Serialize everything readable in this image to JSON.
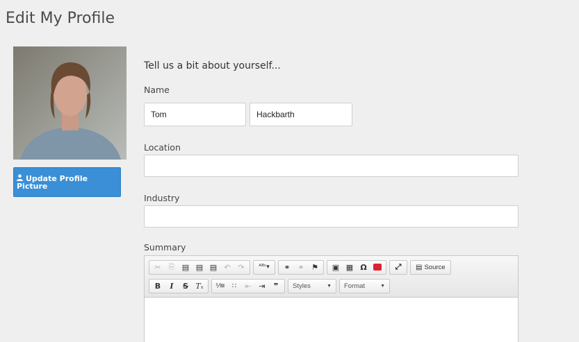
{
  "page_title": "Edit My Profile",
  "profile": {
    "update_button_label": "Update Profile Picture",
    "update_button_icon": "user-icon"
  },
  "form": {
    "intro": "Tell us a bit about yourself...",
    "name_label": "Name",
    "first_name": "Tom",
    "last_name": "Hackbarth",
    "location_label": "Location",
    "location_value": "",
    "industry_label": "Industry",
    "industry_value": "",
    "summary_label": "Summary"
  },
  "editor": {
    "row1": [
      {
        "name": "cut-icon",
        "glyph": "✂",
        "disabled": true
      },
      {
        "name": "copy-icon",
        "glyph": "⎘",
        "disabled": true
      },
      {
        "name": "paste-icon",
        "glyph": "📋",
        "disabled": false
      },
      {
        "name": "paste-text-icon",
        "glyph": "📋",
        "disabled": false
      },
      {
        "name": "paste-word-icon",
        "glyph": "📋",
        "disabled": false
      },
      {
        "name": "undo-icon",
        "glyph": "↶",
        "disabled": true
      },
      {
        "name": "redo-icon",
        "glyph": "↷",
        "disabled": true
      },
      {
        "name": "spellcheck-icon",
        "glyph": "ᴬᴮᶜ▾",
        "disabled": false
      },
      {
        "name": "link-icon",
        "glyph": "🔗",
        "disabled": false
      },
      {
        "name": "unlink-icon",
        "glyph": "⛓",
        "disabled": true
      },
      {
        "name": "anchor-icon",
        "glyph": "⚑",
        "disabled": false
      },
      {
        "name": "image-icon",
        "glyph": "▣",
        "disabled": false
      },
      {
        "name": "table-icon",
        "glyph": "▦",
        "disabled": false
      },
      {
        "name": "special-char-icon",
        "glyph": "Ω",
        "disabled": false
      },
      {
        "name": "youtube-icon",
        "glyph": "",
        "disabled": false
      },
      {
        "name": "maximize-icon",
        "glyph": "⤢",
        "disabled": false
      }
    ],
    "source_label": "Source",
    "row2": [
      {
        "name": "bold-icon",
        "glyph": "B",
        "cls": "b"
      },
      {
        "name": "italic-icon",
        "glyph": "I",
        "cls": "i"
      },
      {
        "name": "strike-icon",
        "glyph": "S",
        "cls": "s"
      },
      {
        "name": "remove-format-icon",
        "glyph": "Tₓ",
        "cls": "i"
      },
      {
        "name": "numbered-list-icon",
        "glyph": "⒈≡",
        "cls": ""
      },
      {
        "name": "bulleted-list-icon",
        "glyph": "•≡",
        "cls": ""
      },
      {
        "name": "outdent-icon",
        "glyph": "⇤",
        "cls": "dis"
      },
      {
        "name": "indent-icon",
        "glyph": "⇥",
        "cls": ""
      },
      {
        "name": "blockquote-icon",
        "glyph": "❞",
        "cls": "b"
      }
    ],
    "styles_label": "Styles",
    "format_label": "Format"
  }
}
